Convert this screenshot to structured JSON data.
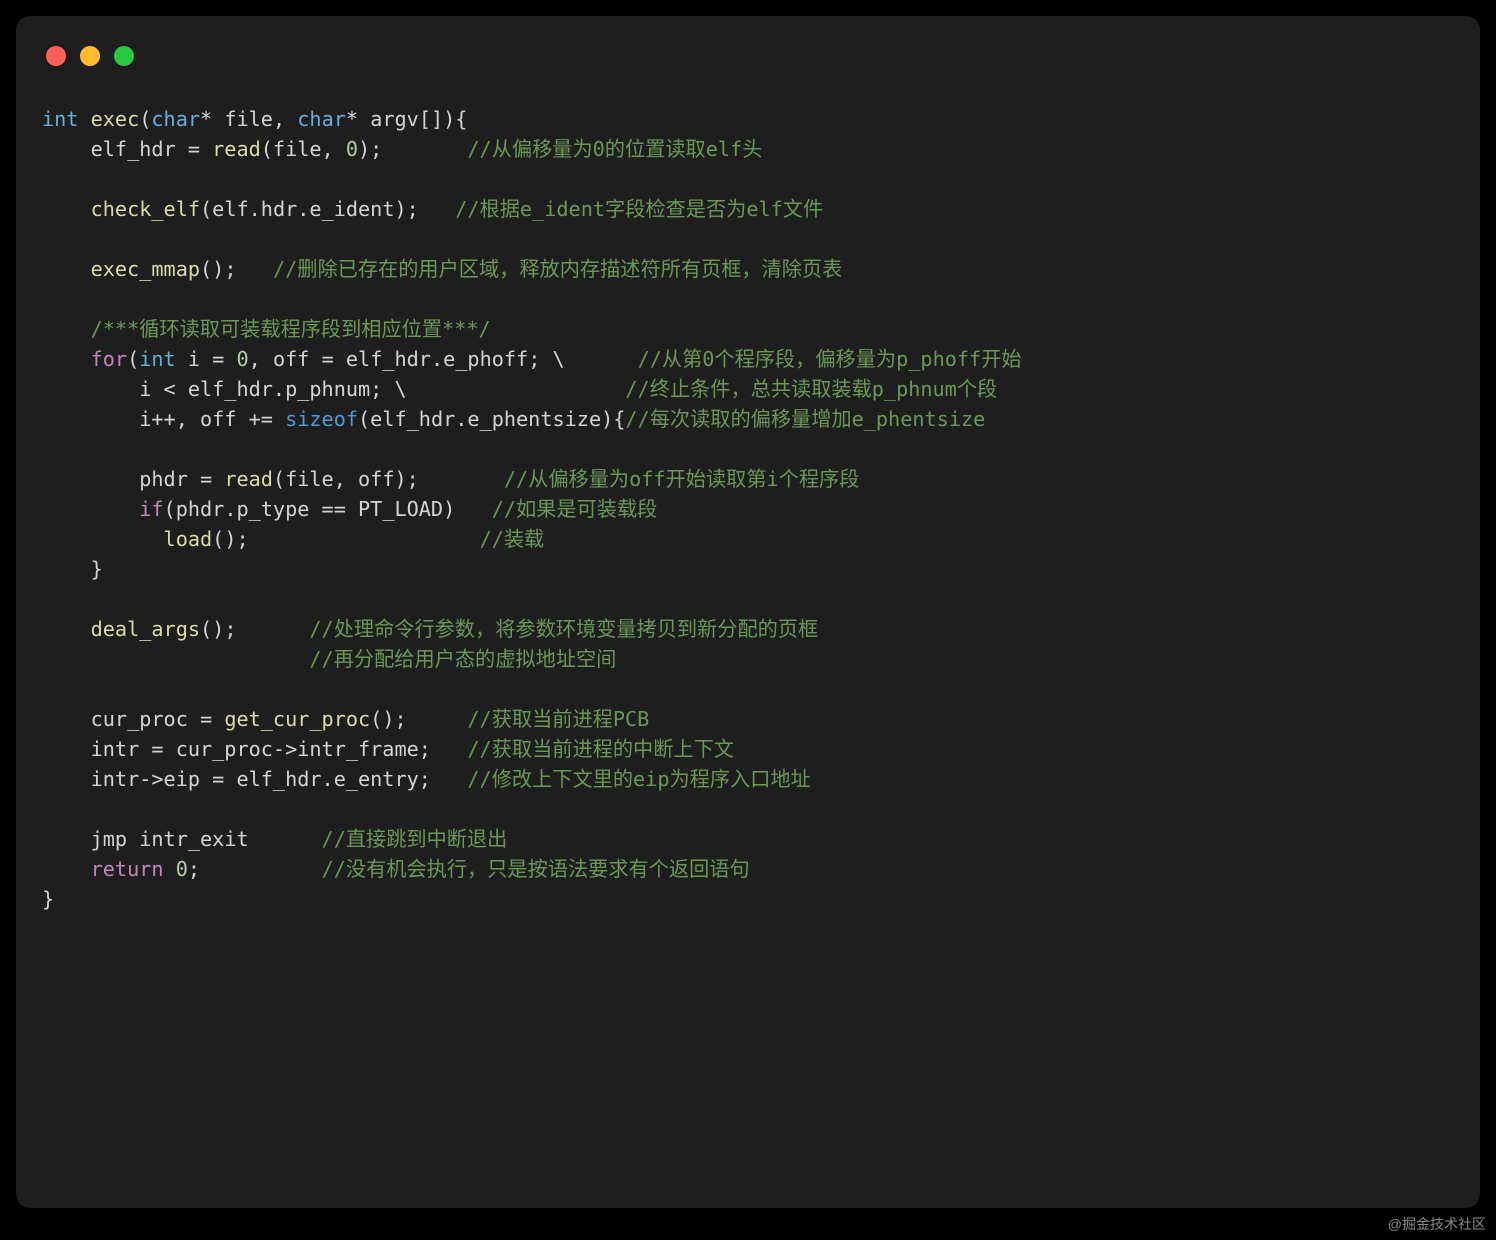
{
  "watermark": "@掘金技术社区",
  "code": {
    "l1": {
      "a": "int",
      "b": " ",
      "c": "exec",
      "d": "(",
      "e": "char",
      "f": "* file, ",
      "g": "char",
      "h": "* argv[]){"
    },
    "l2": {
      "a": "    elf_hdr = ",
      "b": "read",
      "c": "(file, ",
      "d": "0",
      "e": ");       ",
      "f": "//从偏移量为0的位置读取elf头"
    },
    "l3": "",
    "l4": {
      "a": "    ",
      "b": "check_elf",
      "c": "(elf.hdr.e_ident);   ",
      "d": "//根据e_ident字段检查是否为elf文件"
    },
    "l5": "",
    "l6": {
      "a": "    ",
      "b": "exec_mmap",
      "c": "();   ",
      "d": "//删除已存在的用户区域，释放内存描述符所有页框，清除页表"
    },
    "l7": "",
    "l8": {
      "a": "    ",
      "b": "/***循环读取可装载程序段到相应位置***/"
    },
    "l9": {
      "a": "    ",
      "b": "for",
      "c": "(",
      "d": "int",
      "e": " i = ",
      "f": "0",
      "g": ", off = elf_hdr.e_phoff; \\      ",
      "h": "//从第0个程序段，偏移量为p_phoff开始"
    },
    "l10": {
      "a": "        i < elf_hdr.p_phnum; \\                  ",
      "b": "//终止条件，总共读取装载p_phnum个段 "
    },
    "l11": {
      "a": "        i++, off += ",
      "b": "sizeof",
      "c": "(elf_hdr.e_phentsize){",
      "d": "//每次读取的偏移量增加e_phentsize"
    },
    "l12": "",
    "l13": {
      "a": "        phdr = ",
      "b": "read",
      "c": "(file, off);       ",
      "d": "//从偏移量为off开始读取第i个程序段"
    },
    "l14": {
      "a": "        ",
      "b": "if",
      "c": "(phdr.p_type == PT_LOAD)   ",
      "d": "//如果是可装载段"
    },
    "l15": {
      "a": "          ",
      "b": "load",
      "c": "();                   ",
      "d": "//装载"
    },
    "l16": {
      "a": "    }"
    },
    "l17": "",
    "l18": {
      "a": "    ",
      "b": "deal_args",
      "c": "();      ",
      "d": "//处理命令行参数，将参数环境变量拷贝到新分配的页框"
    },
    "l19": {
      "a": "                      ",
      "b": "//再分配给用户态的虚拟地址空间"
    },
    "l20": "",
    "l21": {
      "a": "    cur_proc = ",
      "b": "get_cur_proc",
      "c": "();     ",
      "d": "//获取当前进程PCB"
    },
    "l22": {
      "a": "    intr = cur_proc->intr_frame;   ",
      "b": "//获取当前进程的中断上下文"
    },
    "l23": {
      "a": "    intr->eip = elf_hdr.e_entry;   ",
      "b": "//修改上下文里的eip为程序入口地址"
    },
    "l24": "",
    "l25": {
      "a": "    jmp intr_exit      ",
      "b": "//直接跳到中断退出"
    },
    "l26": {
      "a": "    ",
      "b": "return",
      "c": " ",
      "d": "0",
      "e": ";          ",
      "f": "//没有机会执行，只是按语法要求有个返回语句"
    },
    "l27": {
      "a": "}"
    }
  }
}
